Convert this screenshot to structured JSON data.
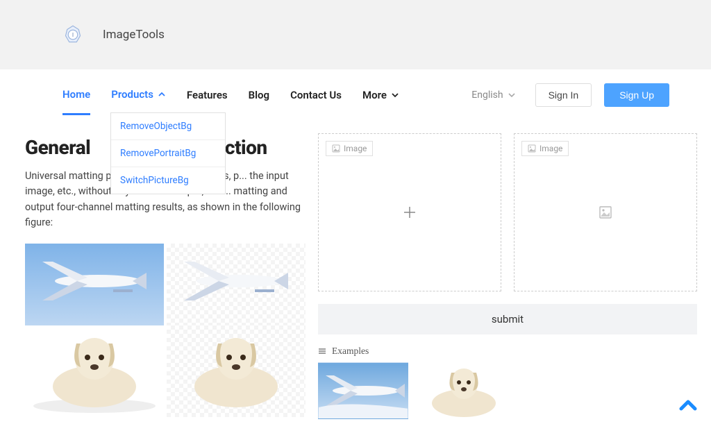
{
  "brand": {
    "name": "ImageTools"
  },
  "nav": {
    "items": [
      "Home",
      "Products",
      "Features",
      "Blog",
      "Contact Us",
      "More"
    ],
    "dropdown": {
      "items": [
        "RemoveObjectBg",
        "RemovePortraitBg",
        "SwitchPictureBg"
      ]
    }
  },
  "lang": {
    "label": "English"
  },
  "auth": {
    "signin": "Sign In",
    "signup": "Sign Up"
  },
  "page": {
    "title_full": "General matting introduction",
    "title_visible_left": "General ",
    "title_visible_right": "oduction",
    "description": "Universal matting products, supporting goods, p... the input image, etc., without any additional input, to a... matting and output four-channel matting results, as shown in the following figure:"
  },
  "uploads": {
    "badge_label": "Image",
    "zone_left_icon": "plus-icon",
    "zone_right_icon": "image-placeholder-icon"
  },
  "actions": {
    "submit": "submit"
  },
  "examples": {
    "header": "Examples",
    "items": [
      {
        "name": "airplane",
        "bg": "sky"
      },
      {
        "name": "dog",
        "bg": "white"
      }
    ]
  }
}
